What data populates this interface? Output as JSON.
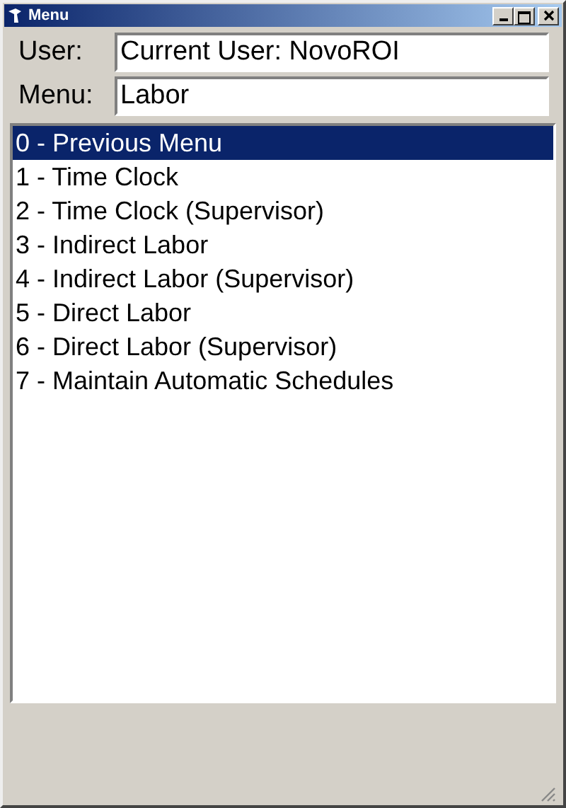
{
  "window": {
    "title": "Menu"
  },
  "fields": [
    {
      "label": "User:",
      "value": "Current User: NovoROI"
    },
    {
      "label": "Menu:",
      "value": "Labor"
    }
  ],
  "menu_items": [
    {
      "label": "0 - Previous Menu",
      "selected": true
    },
    {
      "label": "1 - Time Clock",
      "selected": false
    },
    {
      "label": "2 - Time Clock (Supervisor)",
      "selected": false
    },
    {
      "label": "3 - Indirect Labor",
      "selected": false
    },
    {
      "label": "4 - Indirect Labor (Supervisor)",
      "selected": false
    },
    {
      "label": "5 - Direct Labor",
      "selected": false
    },
    {
      "label": "6 - Direct Labor (Supervisor)",
      "selected": false
    },
    {
      "label": "7 - Maintain Automatic Schedules",
      "selected": false
    }
  ]
}
